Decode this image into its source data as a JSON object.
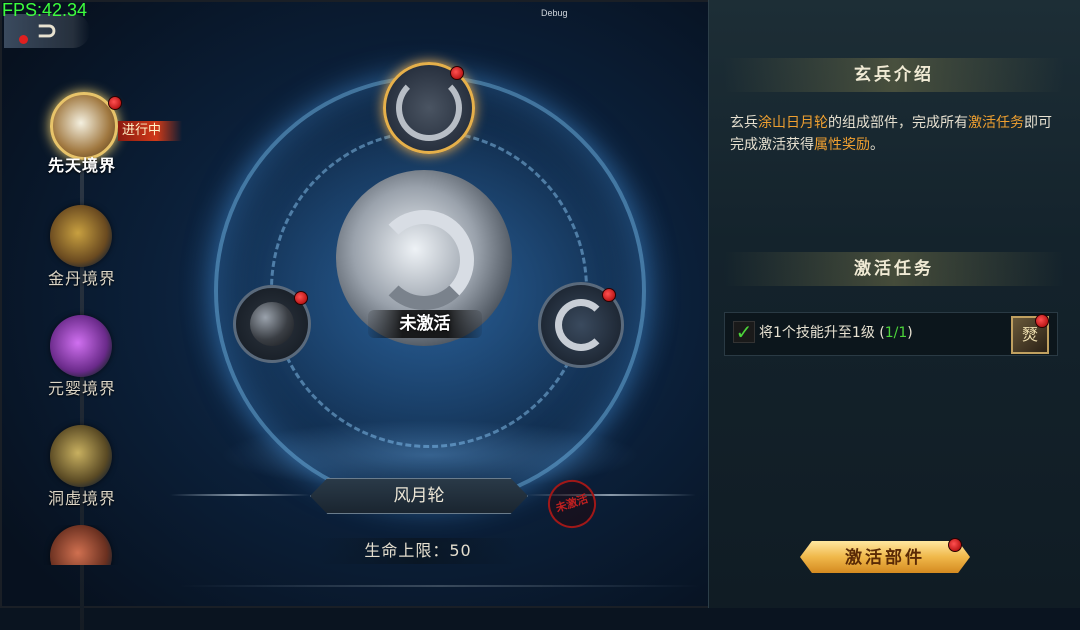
{
  "hud": {
    "fps": "FPS:42.34",
    "debug": "Debug",
    "back_glyph": "⊃"
  },
  "stages": [
    {
      "label": "先天境界",
      "status": "进行中",
      "active": true
    },
    {
      "label": "金丹境界"
    },
    {
      "label": "元婴境界"
    },
    {
      "label": "洞虚境界"
    },
    {
      "label": ""
    }
  ],
  "center": {
    "state_tag": "未激活",
    "part_name": "风月轮",
    "stamp": "未激活",
    "stat": "生命上限：50"
  },
  "panel": {
    "intro_title": "玄兵介绍",
    "intro_text_1": "玄兵",
    "intro_hl_1": "涂山日月轮",
    "intro_text_2": "的组成部件，完成所有",
    "intro_hl_2": "激活任务",
    "intro_text_3": "即可完成激活获得",
    "intro_hl_3": "属性奖励",
    "intro_text_4": "。",
    "tasks_title": "激活任务",
    "task": {
      "text": "将1个技能升至1级 (",
      "progress": "1/1",
      "close": ")",
      "icon_glyph": "燹"
    },
    "activate_button": "激活部件"
  },
  "colors": {
    "highlight": "#f0a030",
    "progress": "#4cd43a",
    "badge": "#e02020"
  }
}
